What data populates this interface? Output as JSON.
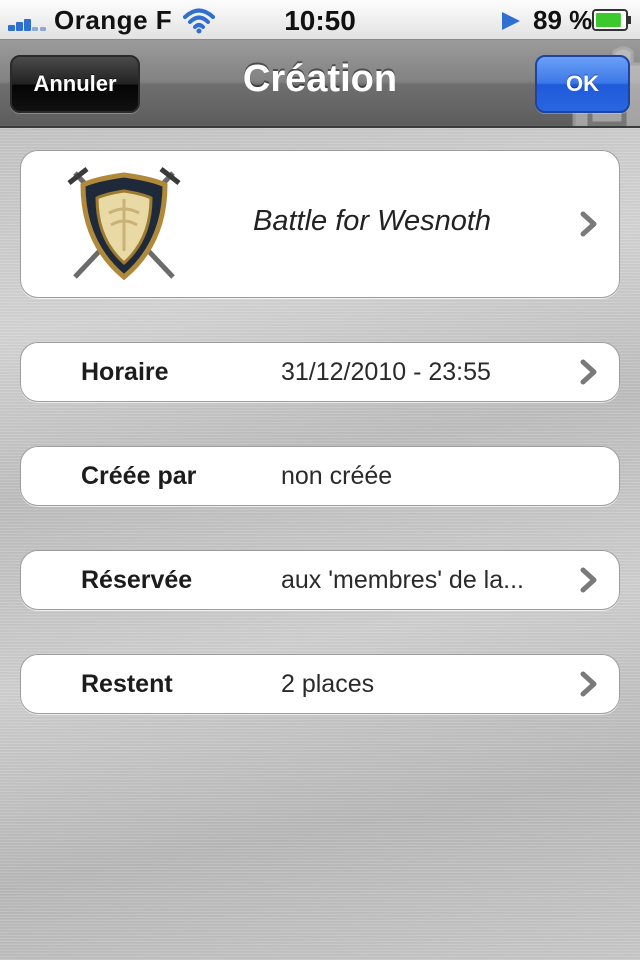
{
  "status_bar": {
    "carrier": "Orange F",
    "time": "10:50",
    "battery_percent": "89 %",
    "battery_level": 0.89,
    "icons": [
      "signal-icon",
      "wifi-icon",
      "location-arrow-icon",
      "battery-icon"
    ]
  },
  "nav": {
    "title": "Création",
    "cancel_label": "Annuler",
    "ok_label": "OK"
  },
  "game": {
    "title": "Battle for Wesnoth",
    "logo": "wesnoth-shield-logo"
  },
  "rows": [
    {
      "label": "Horaire",
      "value": "31/12/2010 - 23:55",
      "has_disclosure": true
    },
    {
      "label": "Créée par",
      "value": "non créée",
      "has_disclosure": false
    },
    {
      "label": "Réservée",
      "value": "aux 'membres' de la...",
      "has_disclosure": true
    },
    {
      "label": "Restent",
      "value": "2 places",
      "has_disclosure": true
    }
  ],
  "colors": {
    "ok_button": "#2a66e0",
    "cancel_button": "#111111",
    "signal": "#2e6fd1",
    "battery_fill": "#3cc92e"
  }
}
